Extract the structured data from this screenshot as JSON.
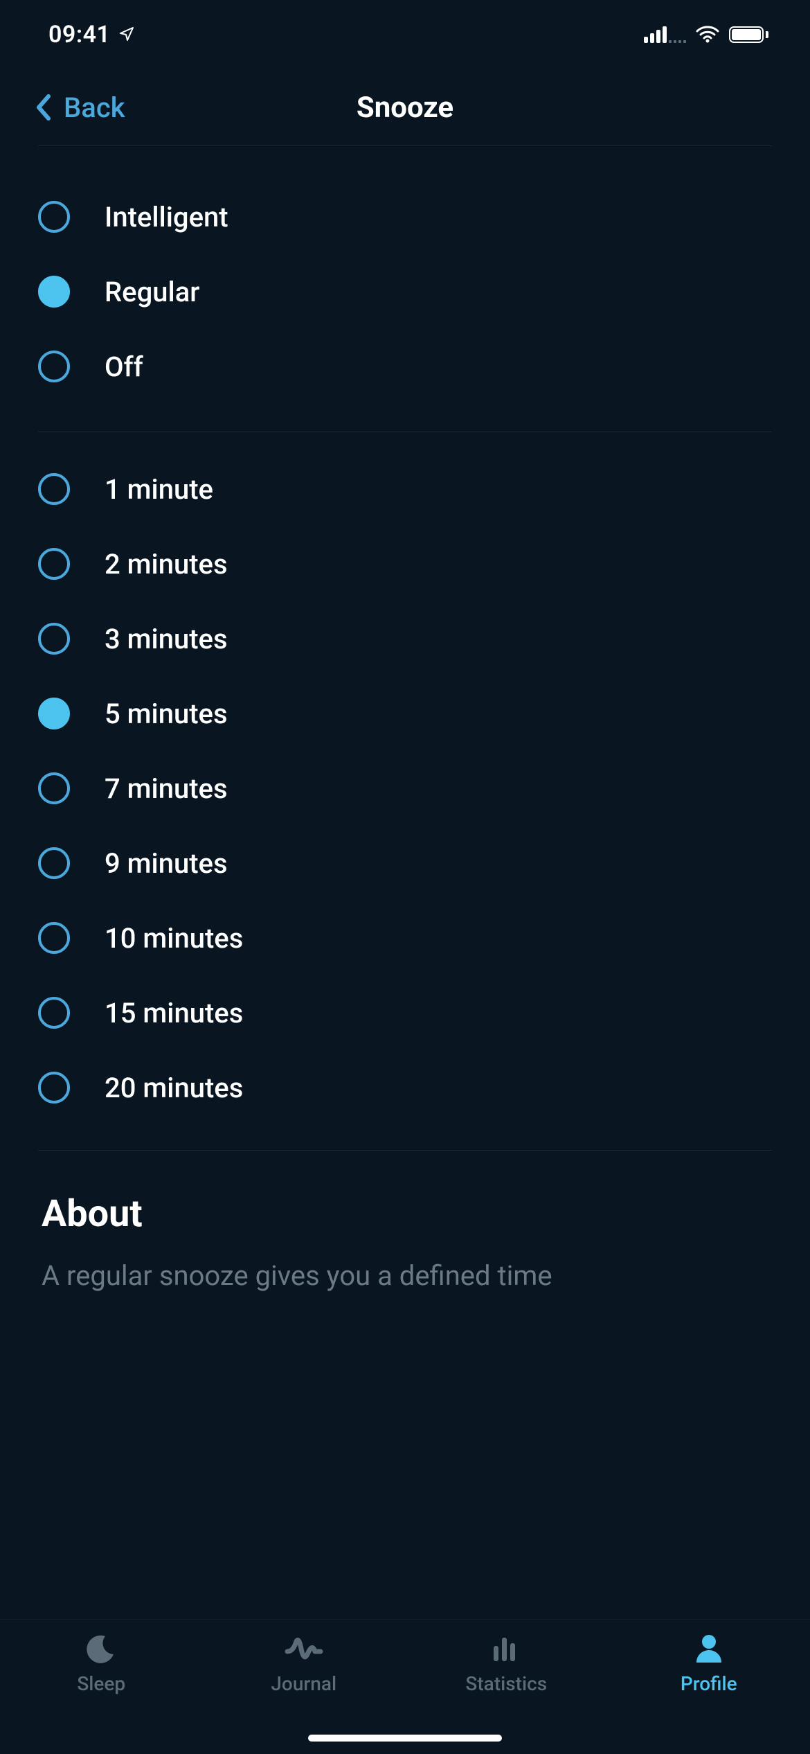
{
  "status": {
    "time": "09:41"
  },
  "nav": {
    "back_label": "Back",
    "title": "Snooze"
  },
  "mode_options": [
    {
      "label": "Intelligent",
      "selected": false
    },
    {
      "label": "Regular",
      "selected": true
    },
    {
      "label": "Off",
      "selected": false
    }
  ],
  "duration_options": [
    {
      "label": "1 minute",
      "selected": false
    },
    {
      "label": "2 minutes",
      "selected": false
    },
    {
      "label": "3 minutes",
      "selected": false
    },
    {
      "label": "5 minutes",
      "selected": true
    },
    {
      "label": "7 minutes",
      "selected": false
    },
    {
      "label": "9 minutes",
      "selected": false
    },
    {
      "label": "10 minutes",
      "selected": false
    },
    {
      "label": "15 minutes",
      "selected": false
    },
    {
      "label": "20 minutes",
      "selected": false
    }
  ],
  "about": {
    "heading": "About",
    "text": "A regular snooze gives you a defined time"
  },
  "tabs": [
    {
      "label": "Sleep",
      "icon": "moon-icon",
      "active": false
    },
    {
      "label": "Journal",
      "icon": "wave-icon",
      "active": false
    },
    {
      "label": "Statistics",
      "icon": "bars-icon",
      "active": false
    },
    {
      "label": "Profile",
      "icon": "person-icon",
      "active": true
    }
  ],
  "colors": {
    "accent": "#4dc4ef",
    "accent_dark": "#4aa8dd",
    "background": "#091520",
    "muted": "#5b6b78"
  }
}
